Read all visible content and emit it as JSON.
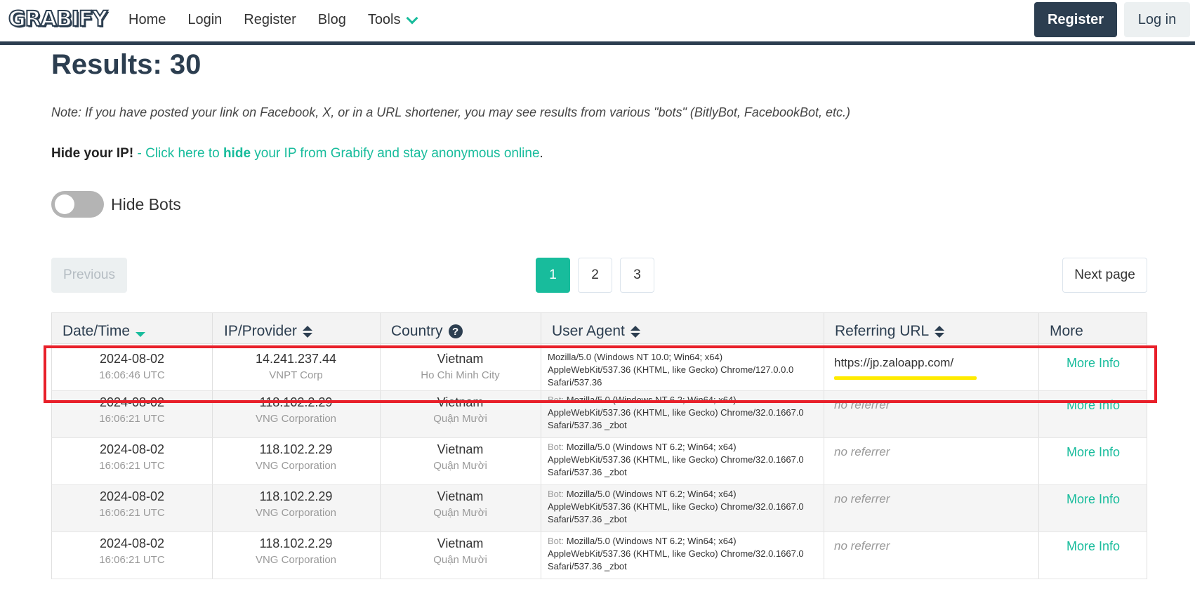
{
  "nav": {
    "logo": "GRABIFY",
    "links": [
      "Home",
      "Login",
      "Register",
      "Blog"
    ],
    "tools": "Tools",
    "register_btn": "Register",
    "login_btn": "Log in"
  },
  "results_title": "Results: 30",
  "note": "Note: If you have posted your link on Facebook, X, or in a URL shortener, you may see results from various \"bots\" (BitlyBot, FacebookBot, etc.)",
  "hide_ip": {
    "bold": "Hide your IP!",
    "dash": " - ",
    "link_pre": "Click here to ",
    "link_bold": "hide",
    "link_post": " your IP from Grabify and stay anonymous online",
    "period": "."
  },
  "hide_bots_label": "Hide Bots",
  "pagination": {
    "previous": "Previous",
    "pages": [
      "1",
      "2",
      "3"
    ],
    "active": "1",
    "next": "Next page"
  },
  "table": {
    "headers": [
      "Date/Time",
      "IP/Provider",
      "Country",
      "User Agent",
      "Referring URL",
      "More"
    ],
    "rows": [
      {
        "date": "2024-08-02",
        "time": "16:06:46 UTC",
        "ip": "14.241.237.44",
        "provider": "VNPT Corp",
        "country": "Vietnam",
        "city": "Ho Chi Minh City",
        "bot_prefix": "",
        "ua": "Mozilla/5.0 (Windows NT 10.0; Win64; x64) AppleWebKit/537.36 (KHTML, like Gecko) Chrome/127.0.0.0 Safari/537.36",
        "ref": "https://jp.zaloapp.com/",
        "more": "More Info"
      },
      {
        "date": "2024-08-02",
        "time": "16:06:21 UTC",
        "ip": "118.102.2.29",
        "provider": "VNG Corporation",
        "country": "Vietnam",
        "city": "Quận Mười",
        "bot_prefix": "Bot: ",
        "ua": "Mozilla/5.0 (Windows NT 6.2; Win64; x64) AppleWebKit/537.36 (KHTML, like Gecko) Chrome/32.0.1667.0 Safari/537.36 _zbot",
        "ref": "no referrer",
        "more": "More Info"
      },
      {
        "date": "2024-08-02",
        "time": "16:06:21 UTC",
        "ip": "118.102.2.29",
        "provider": "VNG Corporation",
        "country": "Vietnam",
        "city": "Quận Mười",
        "bot_prefix": "Bot: ",
        "ua": "Mozilla/5.0 (Windows NT 6.2; Win64; x64) AppleWebKit/537.36 (KHTML, like Gecko) Chrome/32.0.1667.0 Safari/537.36 _zbot",
        "ref": "no referrer",
        "more": "More Info"
      },
      {
        "date": "2024-08-02",
        "time": "16:06:21 UTC",
        "ip": "118.102.2.29",
        "provider": "VNG Corporation",
        "country": "Vietnam",
        "city": "Quận Mười",
        "bot_prefix": "Bot: ",
        "ua": "Mozilla/5.0 (Windows NT 6.2; Win64; x64) AppleWebKit/537.36 (KHTML, like Gecko) Chrome/32.0.1667.0 Safari/537.36 _zbot",
        "ref": "no referrer",
        "more": "More Info"
      },
      {
        "date": "2024-08-02",
        "time": "16:06:21 UTC",
        "ip": "118.102.2.29",
        "provider": "VNG Corporation",
        "country": "Vietnam",
        "city": "Quận Mười",
        "bot_prefix": "Bot: ",
        "ua": "Mozilla/5.0 (Windows NT 6.2; Win64; x64) AppleWebKit/537.36 (KHTML, like Gecko) Chrome/32.0.1667.0 Safari/537.36 _zbot",
        "ref": "no referrer",
        "more": "More Info"
      }
    ]
  },
  "icons": {
    "tools_chevron": "chevron-down-icon",
    "sort": "sort-icon",
    "help": "question-icon"
  },
  "colors": {
    "accent": "#18bc9c",
    "navy": "#2c3e50",
    "highlight_box": "#e8202a",
    "highlight_underline": "#ffeb00"
  }
}
